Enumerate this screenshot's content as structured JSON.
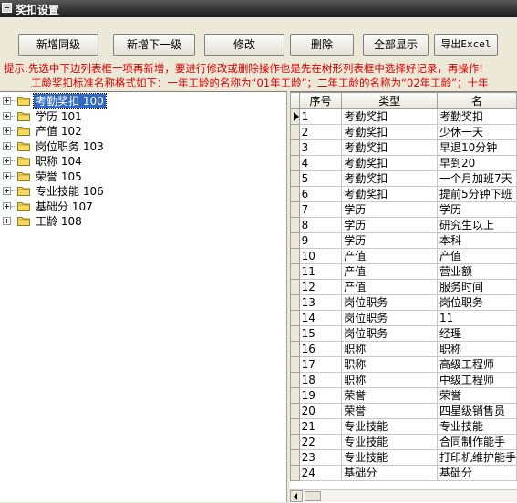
{
  "window": {
    "title": "奖扣设置"
  },
  "toolbar": {
    "buttons": [
      {
        "id": "add-same-level",
        "label": "新增同级"
      },
      {
        "id": "add-sub-level",
        "label": "新增下一级"
      },
      {
        "id": "edit",
        "label": "修改"
      },
      {
        "id": "delete",
        "label": "删除"
      },
      {
        "id": "show-all",
        "label": "全部显示"
      },
      {
        "id": "export-excel",
        "label": "导出Excel"
      }
    ]
  },
  "hints": {
    "line1": "提示:先选中下边列表框一项再新增，要进行修改或删除操作也是先在树形列表框中选择好记录，再操作!",
    "line2": "工龄奖扣标准名称格式如下：一年工龄的名称为“01年工龄”；二年工龄的名称为“02年工龄”；十年"
  },
  "colors": {
    "selection": "#316ac5",
    "hint_text": "#e00000",
    "folder": "#f6d95e"
  },
  "tree": {
    "selected_index": 0,
    "items": [
      {
        "label": "考勤奖扣 100"
      },
      {
        "label": "学历 101"
      },
      {
        "label": "产值 102"
      },
      {
        "label": "岗位职务 103"
      },
      {
        "label": "职称 104"
      },
      {
        "label": "荣誉 105"
      },
      {
        "label": "专业技能 106"
      },
      {
        "label": "基础分 107"
      },
      {
        "label": "工龄 108"
      }
    ]
  },
  "grid": {
    "columns": [
      "序号",
      "类型",
      "名"
    ],
    "current_row": 0,
    "rows": [
      [
        "1",
        "考勤奖扣",
        "考勤奖扣"
      ],
      [
        "2",
        "考勤奖扣",
        "少休一天"
      ],
      [
        "3",
        "考勤奖扣",
        "早退10分钟"
      ],
      [
        "4",
        "考勤奖扣",
        "早到20"
      ],
      [
        "5",
        "考勤奖扣",
        "一个月加班7天"
      ],
      [
        "6",
        "考勤奖扣",
        "提前5分钟下班"
      ],
      [
        "7",
        "学历",
        "学历"
      ],
      [
        "8",
        "学历",
        "研究生以上"
      ],
      [
        "9",
        "学历",
        "本科"
      ],
      [
        "10",
        "产值",
        "产值"
      ],
      [
        "11",
        "产值",
        "营业额"
      ],
      [
        "12",
        "产值",
        "服务时间"
      ],
      [
        "13",
        "岗位职务",
        "岗位职务"
      ],
      [
        "14",
        "岗位职务",
        "11"
      ],
      [
        "15",
        "岗位职务",
        "经理"
      ],
      [
        "16",
        "职称",
        "职称"
      ],
      [
        "17",
        "职称",
        "高级工程师"
      ],
      [
        "18",
        "职称",
        "中级工程师"
      ],
      [
        "19",
        "荣誉",
        "荣誉"
      ],
      [
        "20",
        "荣誉",
        "四星级销售员"
      ],
      [
        "21",
        "专业技能",
        "专业技能"
      ],
      [
        "22",
        "专业技能",
        "合同制作能手"
      ],
      [
        "23",
        "专业技能",
        "打印机维护能手"
      ],
      [
        "24",
        "基础分",
        "基础分"
      ]
    ]
  }
}
